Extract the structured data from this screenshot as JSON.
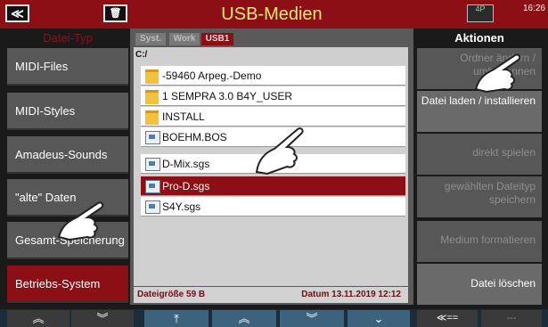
{
  "header": {
    "back_icon": "≪",
    "trash_icon": "🗑",
    "title": "USB-Medien",
    "device_icon_label": "4P",
    "clock": "16:26"
  },
  "left": {
    "heading": "Datei-Typ",
    "items": [
      {
        "label": "MIDI-Files"
      },
      {
        "label": "MIDI-Styles"
      },
      {
        "label": "Amadeus-Sounds"
      },
      {
        "label": "\"alte\" Daten"
      },
      {
        "label": "Gesamt-Speicherung"
      },
      {
        "label": "Betriebs-System"
      }
    ]
  },
  "browser": {
    "tabs": [
      {
        "label": "Syst."
      },
      {
        "label": "Work"
      },
      {
        "label": "USB1"
      }
    ],
    "path": "C:/",
    "files": [
      {
        "name": "-59460 Arpeg.-Demo"
      },
      {
        "name": "1 SEMPRA 3.0 B4Y_USER"
      },
      {
        "name": "INSTALL"
      },
      {
        "name": "BOEHM.BOS"
      },
      {
        "name": "D-Mix.sgs"
      },
      {
        "name": "Pro-D.sgs"
      },
      {
        "name": "S4Y.sgs"
      }
    ],
    "size_label": "Dateigröße 59 B",
    "date_label": "Datum 13.11.2019 12:12"
  },
  "right": {
    "heading": "Aktionen",
    "items": [
      {
        "label": "Ordner ändern / umbenennen"
      },
      {
        "label": "Datei laden / installieren"
      },
      {
        "label": "direkt spielen"
      },
      {
        "label": "gewählten Dateityp speichern"
      },
      {
        "label": "Medium formatieren"
      },
      {
        "label": "Datei löschen"
      }
    ]
  },
  "bottom": {
    "buttons": [
      {
        "label": "︽"
      },
      {
        "label": "︾"
      },
      {
        "label": "⤒"
      },
      {
        "label": "︽"
      },
      {
        "label": "︾"
      },
      {
        "label": "⌄"
      },
      {
        "label": "≪=="
      },
      {
        "label": "---"
      }
    ]
  }
}
